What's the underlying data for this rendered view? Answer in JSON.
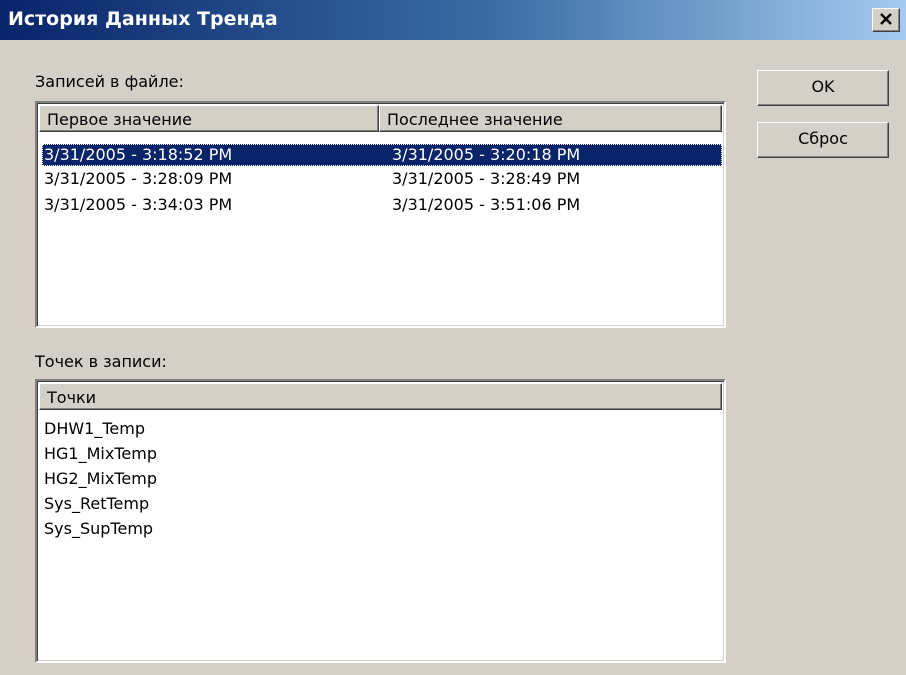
{
  "window": {
    "title": "История Данных Тренда"
  },
  "records": {
    "label": "Записей в файле:",
    "columns": [
      "Первое значение",
      "Последнее значение"
    ],
    "rows": [
      {
        "first": "3/31/2005 - 3:18:52 PM",
        "last": "3/31/2005 - 3:20:18 PM",
        "selected": true
      },
      {
        "first": "3/31/2005 - 3:28:09 PM",
        "last": "3/31/2005 - 3:28:49 PM",
        "selected": false
      },
      {
        "first": "3/31/2005 - 3:34:03 PM",
        "last": "3/31/2005 - 3:51:06 PM",
        "selected": false
      }
    ]
  },
  "points": {
    "label": "Точек в записи:",
    "column": "Точки",
    "items": [
      "DHW1_Temp",
      "HG1_MixTemp",
      "HG2_MixTemp",
      "Sys_RetTemp",
      "Sys_SupTemp"
    ]
  },
  "buttons": {
    "ok_label": "OK",
    "reset_label": "Сброс"
  },
  "icons": {
    "close": "close-icon"
  },
  "colors": {
    "selection": "#0a246a",
    "face": "#d4d0c8"
  }
}
